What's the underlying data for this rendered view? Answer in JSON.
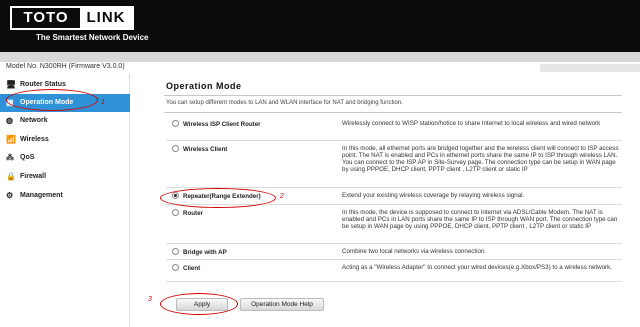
{
  "brand": {
    "logo_left": "TOTO",
    "logo_right": "LINK",
    "tagline": "The Smartest Network Device"
  },
  "model_text": "Model No. N300RH (Firmware V3.0.0)",
  "sidebar": {
    "items": [
      {
        "label": "Router Status",
        "icon": "monitor-icon"
      },
      {
        "label": "Operation Mode",
        "icon": "router-icon",
        "active": true
      },
      {
        "label": "Network",
        "icon": "globe-icon"
      },
      {
        "label": "Wireless",
        "icon": "wifi-icon"
      },
      {
        "label": "QoS",
        "icon": "qos-icon"
      },
      {
        "label": "Firewall",
        "icon": "lock-icon"
      },
      {
        "label": "Management",
        "icon": "gear-icon"
      }
    ]
  },
  "main": {
    "title": "Operation Mode",
    "description": "You can setup different modes to LAN and WLAN interface for NAT and bridging function.",
    "modes": [
      {
        "label": "Wireless ISP Client Router",
        "selected": false,
        "description": "Wirelessly connect to WISP station/hotice to share Internet to local wireless and wired network"
      },
      {
        "label": "Wireless Client",
        "selected": false,
        "description": "In this mode, all ethernet ports are bridged together and the wireless client will connect to ISP access point. The NAT is enabled and PCs in ethernet ports share the same IP to ISP through wireless LAN. You can connect to the ISP AP in Site-Survey page. The connection type can be setup in WAN page by using PPPOE, DHCP client, PPTP client , L2TP client or static IP"
      },
      {
        "label": "Repeater(Range Extender)",
        "selected": true,
        "description": "Extend your existing wireless coverage by relaying wireless signal."
      },
      {
        "label": "Router",
        "selected": false,
        "description": "In this mode, the device is supposed to connect to internet via ADSL/Cable Modem. The NAT is enabled and PCs in LAN ports share the same IP to ISP through WAN port. The connection type can be setup in WAN page by using PPPOE, DHCP client, PPTP client , L2TP client or static IP"
      },
      {
        "label": "Bridge with AP",
        "selected": false,
        "description": "Combine two local networks via wireless connection."
      },
      {
        "label": "Client",
        "selected": false,
        "description": "Acting as a \"Wireless Adapter\" to connect your wired devices(e.g.Xbox/PS3) to a wireless network."
      }
    ],
    "apply_label": "Apply",
    "help_label": "Operation Mode Help"
  },
  "annotations": {
    "n1": "1",
    "n2": "2",
    "n3": "3"
  },
  "colors": {
    "accent": "#2f92d6",
    "annotation": "#d40000",
    "header": "#0b0b0b"
  }
}
